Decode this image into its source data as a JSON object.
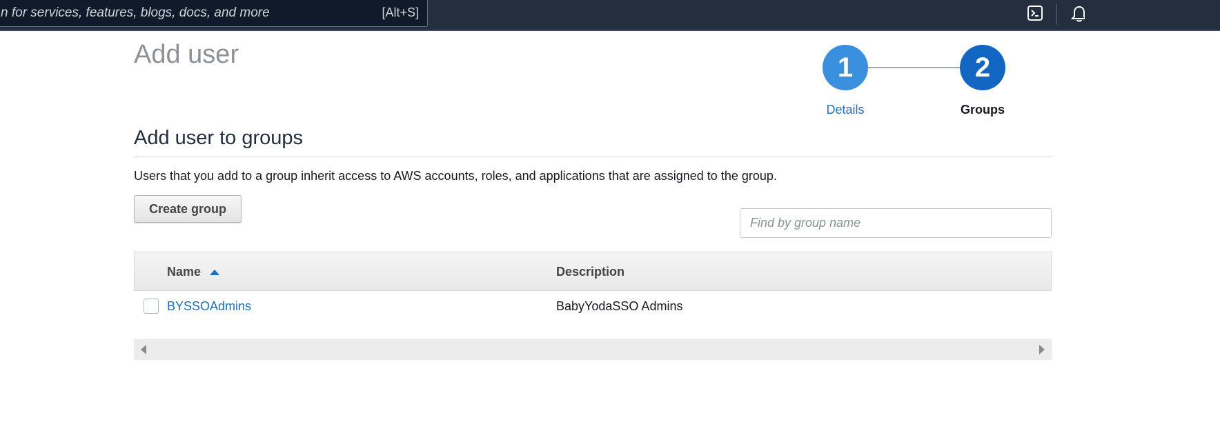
{
  "topbar": {
    "search_placeholder": "n for services, features, blogs, docs, and more",
    "search_shortcut": "[Alt+S]",
    "icons": [
      "cloudshell-icon",
      "bell-icon"
    ],
    "background_color": "#232f3e"
  },
  "page": {
    "title": "Add user"
  },
  "wizard": {
    "steps": [
      {
        "number": "1",
        "label": "Details",
        "state": "completed"
      },
      {
        "number": "2",
        "label": "Groups",
        "state": "current"
      }
    ]
  },
  "section": {
    "title": "Add user to groups",
    "description": "Users that you add to a group inherit access to AWS accounts, roles, and applications that are assigned to the group."
  },
  "actions": {
    "create_group_label": "Create group"
  },
  "filter": {
    "placeholder": "Find by group name",
    "value": ""
  },
  "table": {
    "columns": [
      {
        "label": "Name",
        "sort": "ascending"
      },
      {
        "label": "Description"
      }
    ],
    "rows": [
      {
        "name": "BYSSOAdmins",
        "description": "BabyYodaSSO Admins",
        "checked": false
      }
    ]
  },
  "colors": {
    "link": "#1f6fba",
    "step_completed": "#3b8fdf",
    "step_current": "#1266c2"
  }
}
